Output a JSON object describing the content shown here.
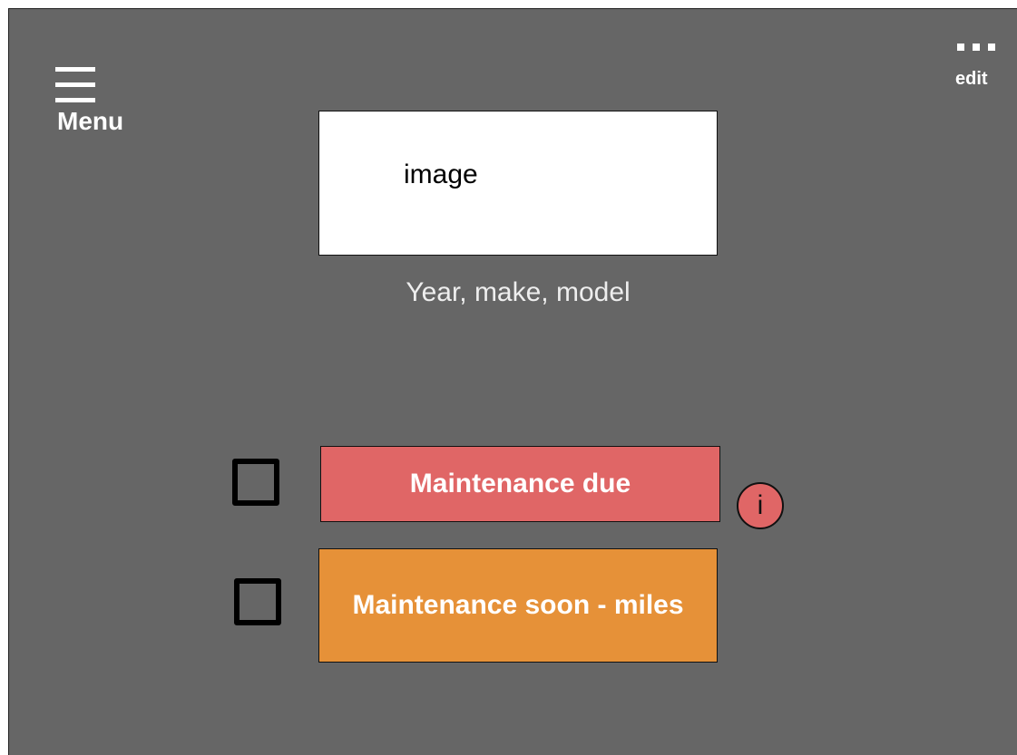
{
  "header": {
    "menu_label": "Menu",
    "menu_icon": "hamburger-icon",
    "edit_label": "edit",
    "edit_icon": "more-dots-icon"
  },
  "vehicle": {
    "image_placeholder": "image",
    "caption": "Year, make, model"
  },
  "maintenance": {
    "items": [
      {
        "label": "Maintenance due",
        "color": "#e06666",
        "checked": false,
        "has_info": true
      },
      {
        "label": "Maintenance soon - miles",
        "color": "#e69138",
        "checked": false,
        "has_info": false
      }
    ],
    "info_glyph": "i",
    "info_icon": "info-icon"
  },
  "colors": {
    "background": "#666666",
    "due": "#e06666",
    "soon": "#e69138",
    "text_light": "#ffffff"
  }
}
